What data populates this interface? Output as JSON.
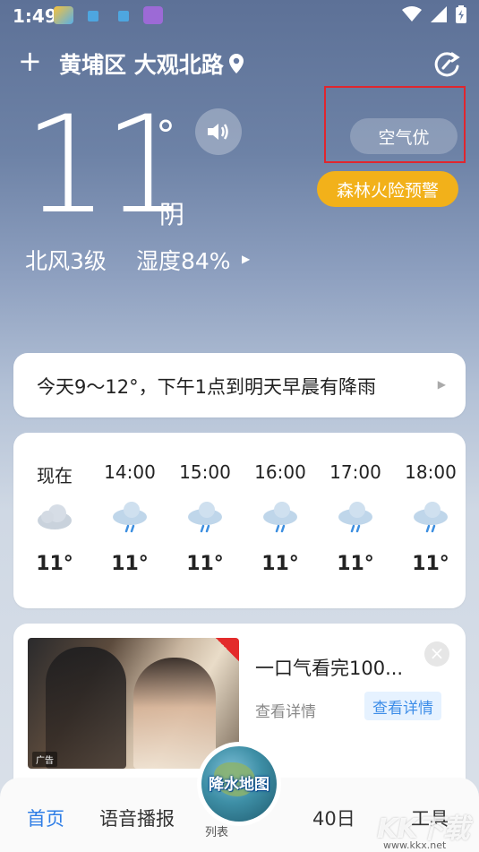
{
  "status_bar": {
    "time": "1:49"
  },
  "header": {
    "location": "黄埔区 大观北路"
  },
  "current": {
    "temperature": "11",
    "degree": "°",
    "condition": "阴",
    "wind": "北风3级",
    "humidity": "湿度84%"
  },
  "badges": {
    "aqi": "空气优",
    "warning": "森林火险预警"
  },
  "summary": {
    "text": "今天9～12°，下午1点到明天早晨有降雨"
  },
  "hourly": [
    {
      "time": "现在",
      "temp": "11°",
      "icon": "cloudy-icon"
    },
    {
      "time": "14:00",
      "temp": "11°",
      "icon": "rain-icon"
    },
    {
      "time": "15:00",
      "temp": "11°",
      "icon": "rain-icon"
    },
    {
      "time": "16:00",
      "temp": "11°",
      "icon": "rain-icon"
    },
    {
      "time": "17:00",
      "temp": "11°",
      "icon": "rain-icon"
    },
    {
      "time": "18:00",
      "temp": "11°",
      "icon": "rain-icon"
    }
  ],
  "ad": {
    "title": "一口气看完100...",
    "detail": "查看详情",
    "cta": "查看详情",
    "tag": "广告",
    "close": "×"
  },
  "bottom_nav": {
    "home": "首页",
    "voice": "语音播报",
    "center": "降水地图",
    "center_sub": "列表",
    "forecast40": "40日",
    "tools": "工具"
  },
  "watermark": {
    "text": "KK下载",
    "url": "www.kkx.net"
  },
  "colors": {
    "accent": "#2f7ee6",
    "warning": "#f2b11a",
    "highlight_box": "#e0262e"
  }
}
